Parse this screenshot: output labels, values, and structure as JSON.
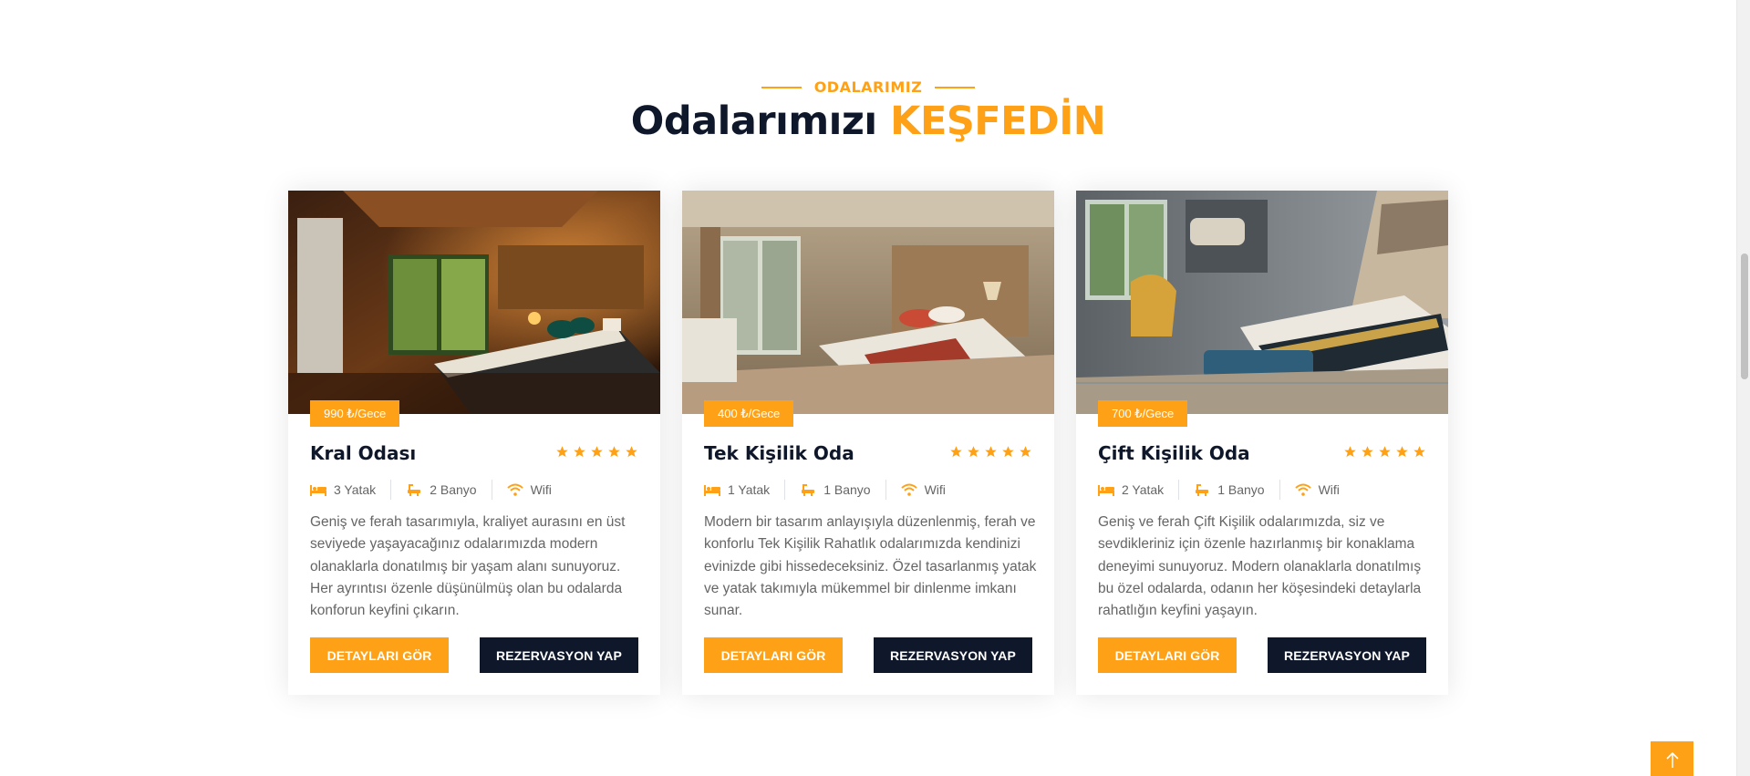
{
  "section": {
    "subtitle": "ODALARIMIZ",
    "title_main": "Odalarımızı",
    "title_accent": "KEŞFEDİN"
  },
  "colors": {
    "accent": "#fea116",
    "dark": "#0f172b",
    "text": "#666565"
  },
  "rooms": [
    {
      "price": "990 ₺/Gece",
      "name": "Kral Odası",
      "rating": 5,
      "features": [
        {
          "icon": "bed-icon",
          "label": "3 Yatak"
        },
        {
          "icon": "bath-icon",
          "label": "2 Banyo"
        },
        {
          "icon": "wifi-icon",
          "label": "Wifi"
        }
      ],
      "description": "Geniş ve ferah tasarımıyla, kraliyet aurasını en üst seviyede yaşayacağınız odalarımızda modern olanaklarla donatılmış bir yaşam alanı sunuyoruz. Her ayrıntısı özenle düşünülmüş olan bu odalarda konforun keyfini çıkarın.",
      "details_label": "DETAYLARI GÖR",
      "reserve_label": "REZERVASYON YAP"
    },
    {
      "price": "400 ₺/Gece",
      "name": "Tek Kişilik Oda",
      "rating": 5,
      "features": [
        {
          "icon": "bed-icon",
          "label": "1 Yatak"
        },
        {
          "icon": "bath-icon",
          "label": "1 Banyo"
        },
        {
          "icon": "wifi-icon",
          "label": "Wifi"
        }
      ],
      "description": "Modern bir tasarım anlayışıyla düzenlenmiş, ferah ve konforlu Tek Kişilik Rahatlık odalarımızda kendinizi evinizde gibi hissedeceksiniz. Özel tasarlanmış yatak ve yatak takımıyla mükemmel bir dinlenme imkanı sunar.",
      "details_label": "DETAYLARI GÖR",
      "reserve_label": "REZERVASYON YAP"
    },
    {
      "price": "700 ₺/Gece",
      "name": "Çift Kişilik Oda",
      "rating": 5,
      "features": [
        {
          "icon": "bed-icon",
          "label": "2 Yatak"
        },
        {
          "icon": "bath-icon",
          "label": "1 Banyo"
        },
        {
          "icon": "wifi-icon",
          "label": "Wifi"
        }
      ],
      "description": "Geniş ve ferah Çift Kişilik odalarımızda, siz ve sevdikleriniz için özenle hazırlanmış bir konaklama deneyimi sunuyoruz. Modern olanaklarla donatılmış bu özel odalarda, odanın her köşesindeki detaylarla rahatlığın keyfini yaşayın.",
      "details_label": "DETAYLARI GÖR",
      "reserve_label": "REZERVASYON YAP"
    }
  ],
  "back_to_top_icon": "arrow-up-icon"
}
